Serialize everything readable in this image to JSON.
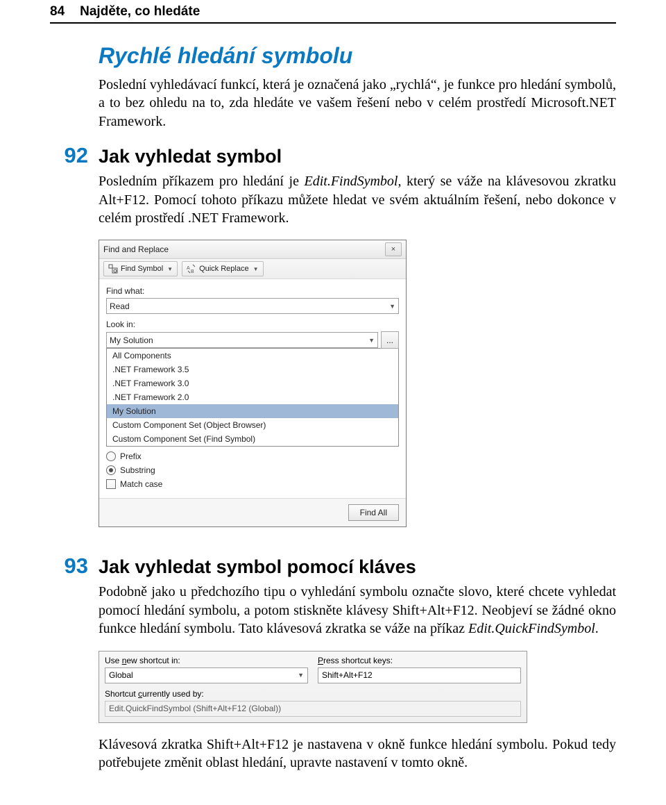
{
  "header": {
    "page_number": "84",
    "chapter_title": "Najděte, co hledáte"
  },
  "section_main": {
    "title": "Rychlé hledání symbolu",
    "para": "Poslední vyhledávací funkcí, která je označená jako „rychlá“, je funkce pro hledání symbolů, a to bez ohledu na to, zda hledáte ve vašem řešení nebo v celém prostředí Microsoft.NET Framework."
  },
  "tip92": {
    "number": "92",
    "title": "Jak vyhledat symbol",
    "para_before_em": "Posledním příkazem pro hledání je ",
    "para_em": "Edit.FindSymbol",
    "para_after_em": ", který se váže na klávesovou zkratku Alt+F12. Pomocí tohoto příkazu můžete hledat ve svém aktuálním řešení, nebo dokonce v celém prostředí .NET Framework."
  },
  "dlg1": {
    "title": "Find and Replace",
    "close": "×",
    "tb_find_symbol": "Find Symbol",
    "tb_quick_replace": "Quick Replace",
    "find_what_label": "Find what:",
    "find_what_value": "Read",
    "look_in_label": "Look in:",
    "look_in_value": "My Solution",
    "dots": "...",
    "options": [
      "All Components",
      ".NET Framework 3.5",
      ".NET Framework 3.0",
      ".NET Framework 2.0",
      "My Solution",
      "Custom Component Set (Object Browser)",
      "Custom Component Set (Find Symbol)"
    ],
    "radio_prefix": "Prefix",
    "radio_substring": "Substring",
    "check_match_case": "Match case",
    "find_all": "Find All"
  },
  "tip93": {
    "number": "93",
    "title": "Jak vyhledat symbol pomocí kláves",
    "para_a": "Podobně jako u předchozího tipu o vyhledání symbolu označte slovo, které chcete vyhledat pomocí hledání symbolu, a potom stiskněte klávesy Shift+Alt+F12. Neobjeví se žádné okno funkce hledání symbolu. Tato klávesová zkratka se váže na příkaz ",
    "para_a_em": "Edit.QuickFindSymbol",
    "para_a_tail": "."
  },
  "dlg2": {
    "use_label_pre": "Use ",
    "use_label_u": "n",
    "use_label_post": "ew shortcut in:",
    "use_value": "Global",
    "press_label_u": "P",
    "press_label_post": "ress shortcut keys:",
    "press_value": "Shift+Alt+F12",
    "current_label_pre": "Shortcut ",
    "current_label_u": "c",
    "current_label_post": "urrently used by:",
    "current_value": "Edit.QuickFindSymbol (Shift+Alt+F12 (Global))"
  },
  "footer": {
    "para": "Klávesová zkratka Shift+Alt+F12 je nastavena v okně funkce hledání symbolu. Pokud tedy potřebujete změnit oblast hledání, upravte nastavení v tomto okně."
  }
}
